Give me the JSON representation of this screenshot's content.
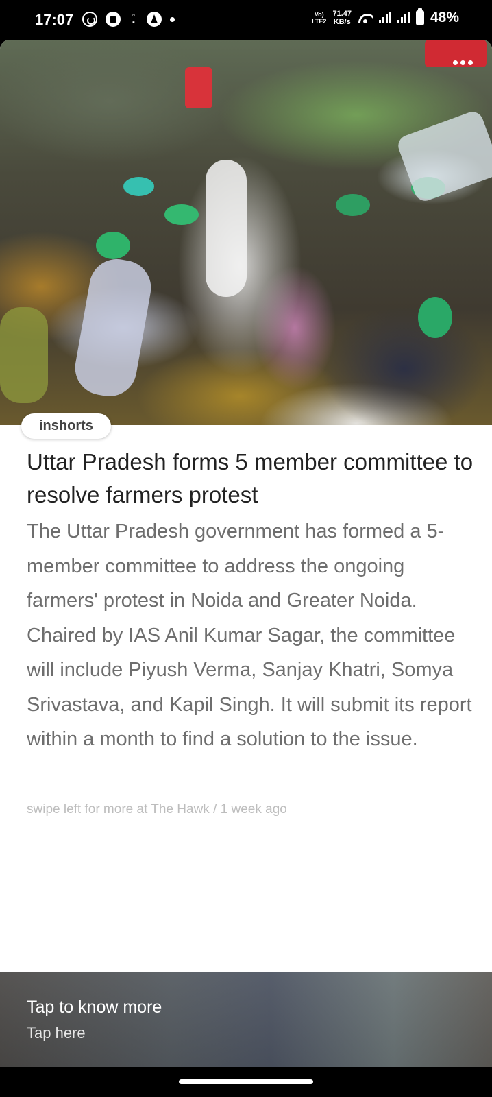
{
  "status_bar": {
    "time": "17:07",
    "icons_left": [
      "whatsapp-icon",
      "bag-icon",
      "sim-icon",
      "navigation-icon",
      "dot-icon"
    ],
    "volte": "LTE2",
    "speed_value": "71.47",
    "speed_unit": "KB/s",
    "battery": "48%"
  },
  "article": {
    "source": "inshorts",
    "headline": "Uttar Pradesh forms 5 member committee to resolve farmers protest",
    "summary": "The Uttar Pradesh government has formed a 5-member committee to address the ongoing farmers' protest in Noida and Greater Noida. Chaired by IAS Anil Kumar Sagar, the committee will include Piyush Verma, Sanjay Khatri, Somya Srivastava, and Kapil Singh. It will submit its report within a month to find a solution to the issue.",
    "byline": "swipe left for more at The Hawk / 1 week ago"
  },
  "bottom_panel": {
    "title": "Tap to know more",
    "subtitle": "Tap here"
  }
}
